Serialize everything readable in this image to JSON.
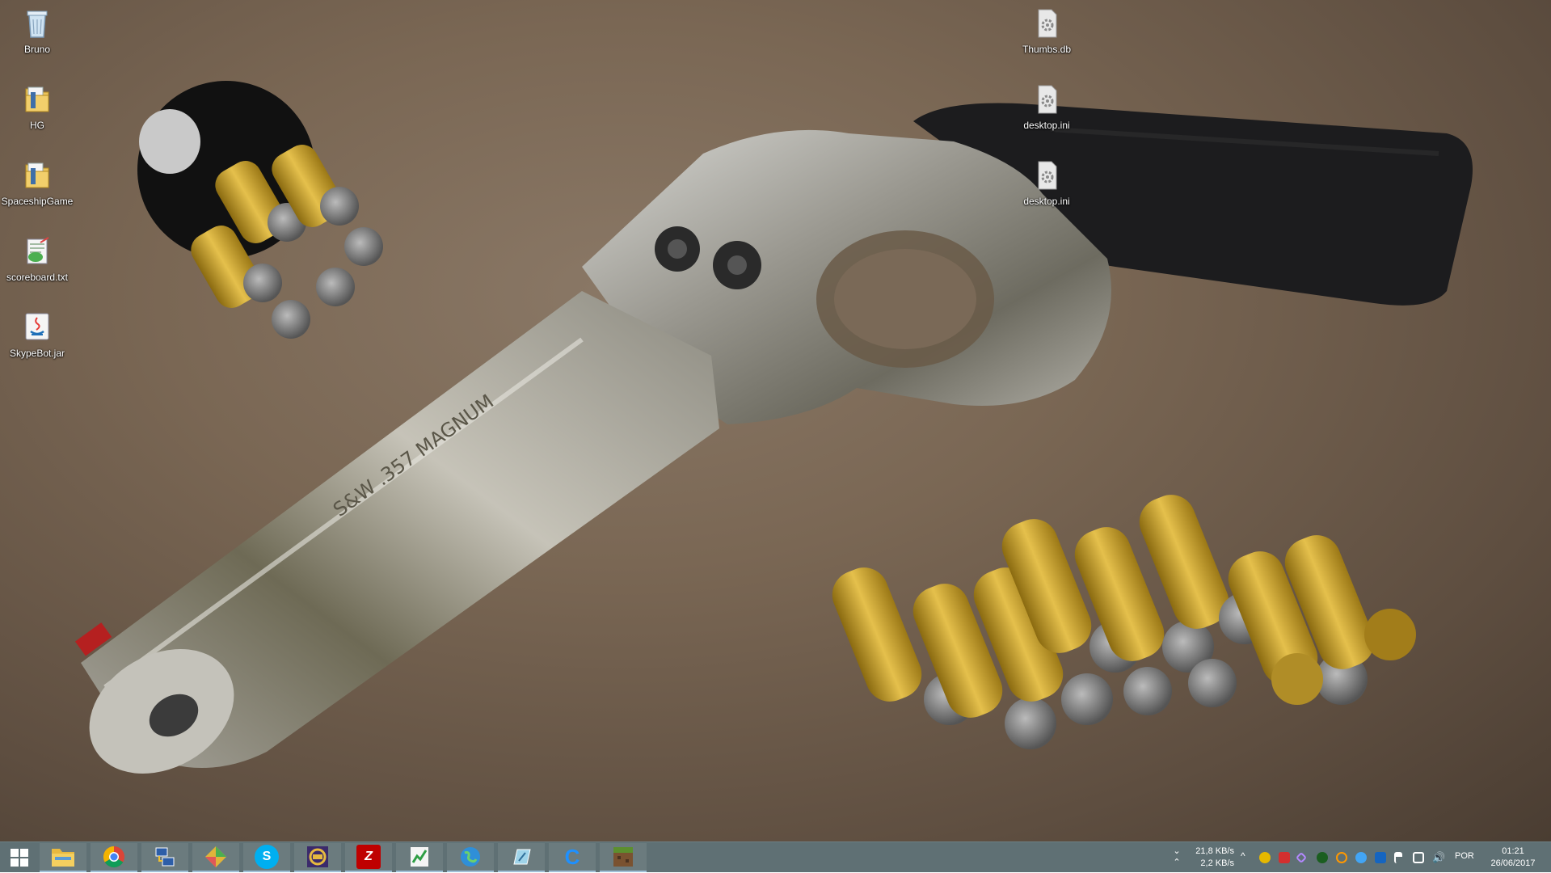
{
  "desktop": {
    "icons": [
      {
        "label": "Bruno",
        "icon": "recycle-bin-icon"
      },
      {
        "label": "HG",
        "icon": "folder-icon"
      },
      {
        "label": "SpaceshipGame",
        "icon": "folder-icon"
      },
      {
        "label": "scoreboard.txt",
        "icon": "text-file-icon"
      },
      {
        "label": "SkypeBot.jar",
        "icon": "java-file-icon"
      },
      {
        "label": "Thumbs.db",
        "icon": "settings-file-icon"
      },
      {
        "label": "desktop.ini",
        "icon": "settings-file-icon"
      },
      {
        "label": "desktop.ini",
        "icon": "settings-file-icon"
      }
    ],
    "wallpaper": {
      "engraving": "S&W .357 MAGNUM"
    }
  },
  "taskbar": {
    "background": "#5f7074",
    "apps": [
      {
        "name": "file-explorer",
        "icon": "folder-icon"
      },
      {
        "name": "chrome",
        "icon": "chrome-icon"
      },
      {
        "name": "network-tool",
        "icon": "network-icon"
      },
      {
        "name": "game-launcher",
        "icon": "diamond-icon"
      },
      {
        "name": "skype",
        "icon": "skype-icon",
        "glyph": "S"
      },
      {
        "name": "java-ee-ide",
        "icon": "java-ee-icon"
      },
      {
        "name": "filezilla",
        "icon": "filezilla-icon",
        "glyph": "Z"
      },
      {
        "name": "notepad-plus",
        "icon": "notepad-chart-icon"
      },
      {
        "name": "globe-app",
        "icon": "globe-icon"
      },
      {
        "name": "editor-app",
        "icon": "pen-icon"
      },
      {
        "name": "ccleaner",
        "icon": "c-icon",
        "glyph": "C"
      },
      {
        "name": "minecraft",
        "icon": "minecraft-icon"
      }
    ],
    "net_down": "21,8 KB/s",
    "net_up": "2,2 KB/s",
    "language": "POR",
    "time": "01:21",
    "date": "26/06/2017"
  }
}
